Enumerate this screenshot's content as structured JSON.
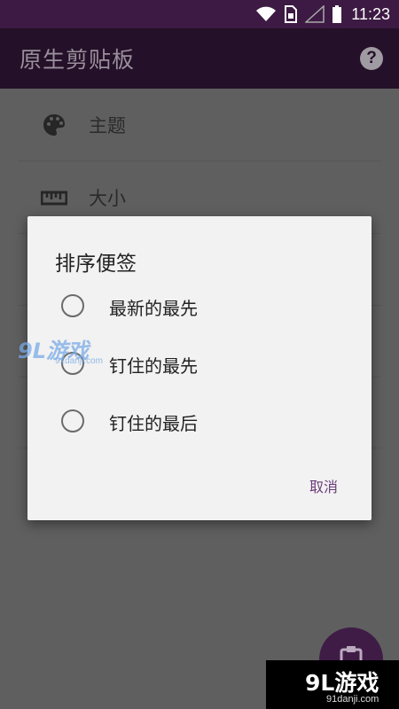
{
  "status_bar": {
    "time": "11:23",
    "icons": [
      "wifi-icon",
      "sim-card-icon",
      "signal-icon",
      "battery-icon"
    ]
  },
  "app_bar": {
    "title": "原生剪贴板",
    "help_glyph": "?"
  },
  "settings": {
    "items": [
      {
        "label": "主题",
        "icon": "palette-icon"
      },
      {
        "label": "大小",
        "icon": "ruler-icon"
      }
    ]
  },
  "dialog": {
    "title": "排序便签",
    "options": [
      {
        "label": "最新的最先",
        "selected": false
      },
      {
        "label": "钉住的最先",
        "selected": false
      },
      {
        "label": "钉住的最后",
        "selected": false
      }
    ],
    "cancel_label": "取消"
  },
  "watermarks": {
    "mid": "9L游戏",
    "mid_sub": "91danji.com",
    "bottom": "9L游戏",
    "bottom_sub": "91danji.com"
  },
  "colors": {
    "status_bar": "#3d1a43",
    "app_bar": "#241028",
    "accent": "#6a3b78",
    "dialog_bg": "#f2f2f2",
    "scrim_bg": "#5f5f5f"
  }
}
